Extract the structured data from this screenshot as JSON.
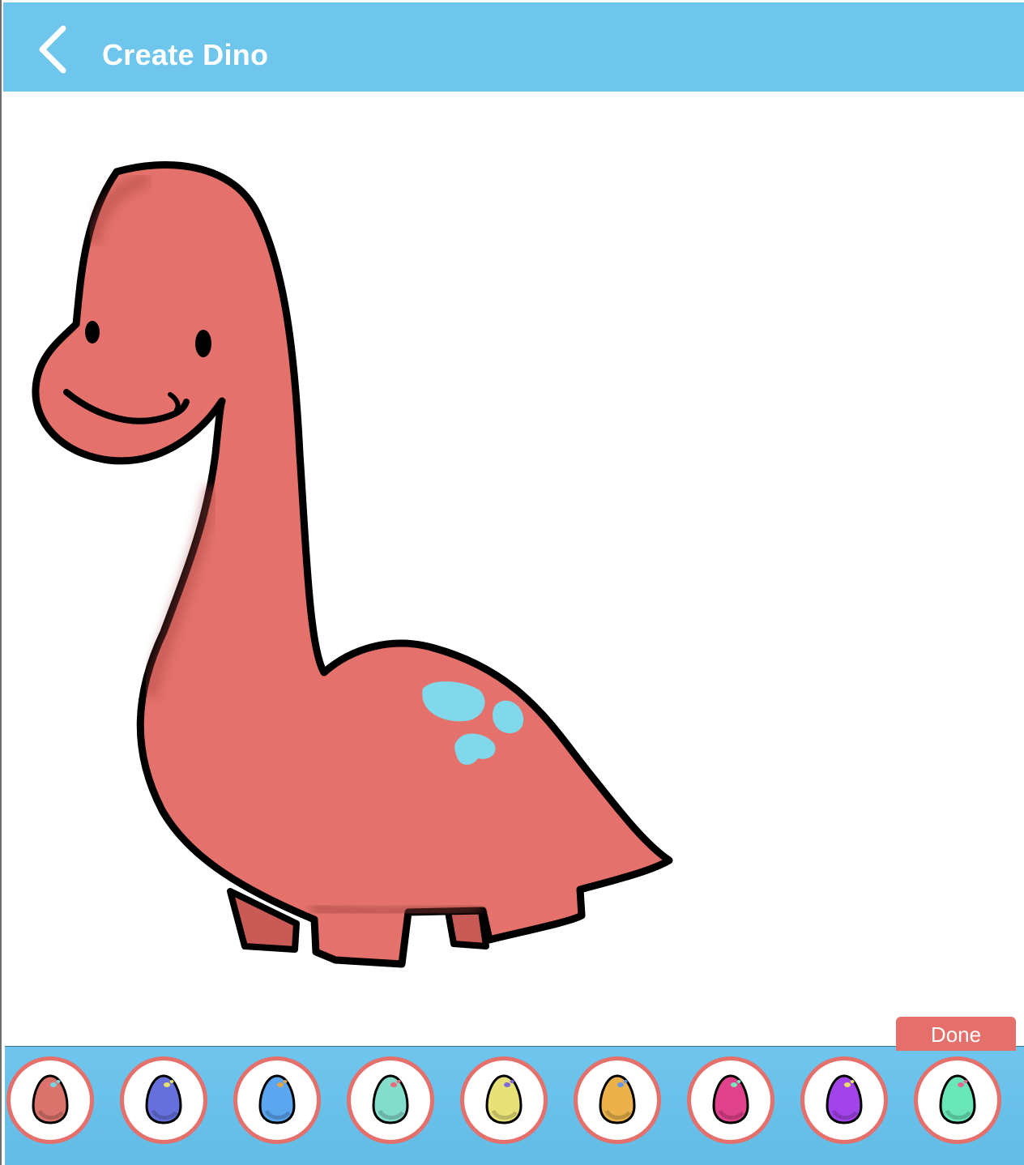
{
  "header": {
    "title": "Create Dino",
    "back_icon": "chevron-left-icon",
    "color": "#6ec6ed"
  },
  "dino": {
    "body_color": "#e4716b",
    "spot_color": "#80d8ea",
    "outline_color": "#000000"
  },
  "done_label": "Done",
  "palette": {
    "selected_index": 0,
    "eggs": [
      {
        "name": "red",
        "color": "#d9736c",
        "fleck": "#7cd3e6"
      },
      {
        "name": "indigo",
        "color": "#6670dc",
        "fleck": "#e5e06a"
      },
      {
        "name": "blue",
        "color": "#5aa6ef",
        "fleck": "#e4a24a"
      },
      {
        "name": "teal",
        "color": "#84dcca",
        "fleck": "#e86a7e"
      },
      {
        "name": "yellow",
        "color": "#e7e177",
        "fleck": "#7e6adc"
      },
      {
        "name": "orange",
        "color": "#ebb24c",
        "fleck": "#6c97e6"
      },
      {
        "name": "pink",
        "color": "#e0428c",
        "fleck": "#7ce3ba"
      },
      {
        "name": "purple",
        "color": "#a344ea",
        "fleck": "#e9e06a"
      },
      {
        "name": "mint",
        "color": "#6ae7b8",
        "fleck": "#e06a96"
      }
    ]
  }
}
